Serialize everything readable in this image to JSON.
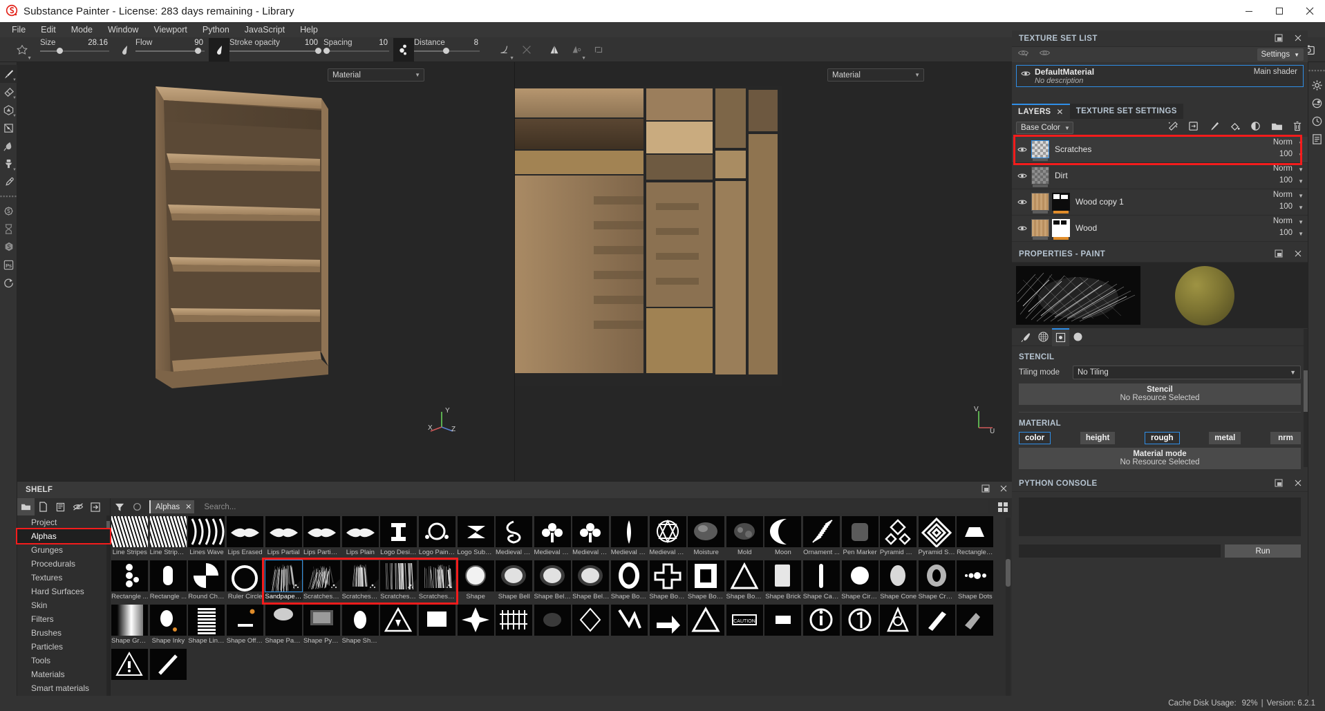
{
  "window": {
    "title": "Substance Painter - License: 283 days remaining - Library",
    "minimize": "minimize-icon",
    "maximize": "maximize-icon",
    "close": "close-icon"
  },
  "menubar": {
    "items": [
      "File",
      "Edit",
      "Mode",
      "Window",
      "Viewport",
      "Python",
      "JavaScript",
      "Help"
    ]
  },
  "toolbar": {
    "params": [
      {
        "name": "Size",
        "value": "28.16",
        "fill_pct": 28
      },
      {
        "name": "Flow",
        "value": "90",
        "fill_pct": 90
      },
      {
        "name": "Stroke opacity",
        "value": "100",
        "fill_pct": 100
      },
      {
        "name": "Spacing",
        "value": "10",
        "fill_pct": 10
      },
      {
        "name": "Distance",
        "value": "8",
        "fill_pct": 48
      }
    ],
    "icons": [
      "brush-preset-icon",
      "flow-icon",
      "opacity-icon",
      "spacing-icon",
      "falloff-icon",
      "symmetry-off-icon",
      "symmetry-icon",
      "symmetry-axis-icon",
      "tri-planar-icon",
      "pause-engine-icon",
      "uv-view-icon",
      "3d-view-icon",
      "camera-view-icon",
      "screenshot-icon"
    ]
  },
  "left_rail": {
    "tools": [
      "paint-brush-icon",
      "eraser-icon",
      "projection-icon",
      "polygon-fill-icon",
      "smudge-icon",
      "clone-stamp-icon",
      "color-picker-icon",
      "material-picker-icon",
      "bake-icon",
      "substance-icon",
      "photoshop-icon",
      "refresh-icon"
    ]
  },
  "right_rail": {
    "tools": [
      "display-settings-icon",
      "shader-settings-icon",
      "history-icon",
      "log-icon"
    ]
  },
  "viewports": {
    "view3d": {
      "channel": "Material",
      "axis": {
        "x": "X",
        "y": "Y",
        "z": "Z"
      }
    },
    "view2d": {
      "channel": "Material",
      "axis": {
        "u": "U",
        "v": "V"
      }
    }
  },
  "shelf": {
    "title": "SHELF",
    "tools": [
      "folder-icon",
      "new-icon",
      "save-icon",
      "hide-icon",
      "import-icon"
    ],
    "filter_icon": "filter-icon",
    "refresh_icon": "refresh-circle-icon",
    "chip": "Alphas",
    "chip_close": "close-icon",
    "search_placeholder": "Search...",
    "grid_view_icon": "grid-view-icon",
    "categories": [
      "Project",
      "Alphas",
      "Grunges",
      "Procedurals",
      "Textures",
      "Hard Surfaces",
      "Skin",
      "Filters",
      "Brushes",
      "Particles",
      "Tools",
      "Materials",
      "Smart materials"
    ],
    "selected_category": "Alphas",
    "highlighted_category": "Alphas",
    "items": [
      {
        "label": "Line Stripes",
        "icon": "alpha-line-stripes"
      },
      {
        "label": "Line Stripes ...",
        "icon": "alpha-line-stripes-2"
      },
      {
        "label": "Lines Wave",
        "icon": "alpha-lines-wave"
      },
      {
        "label": "Lips Erased",
        "icon": "alpha-lips-erased"
      },
      {
        "label": "Lips Partial",
        "icon": "alpha-lips-partial"
      },
      {
        "label": "Lips Partial ...",
        "icon": "alpha-lips-partial-2"
      },
      {
        "label": "Lips Plain",
        "icon": "alpha-lips-plain"
      },
      {
        "label": "Logo Desig...",
        "icon": "alpha-logo-designer"
      },
      {
        "label": "Logo Painter",
        "icon": "alpha-logo-painter"
      },
      {
        "label": "Logo Subst...",
        "icon": "alpha-logo-substance"
      },
      {
        "label": "Medieval Ce...",
        "icon": "alpha-medieval-celtic"
      },
      {
        "label": "Medieval Fl...",
        "icon": "alpha-medieval-flower"
      },
      {
        "label": "Medieval Fl...",
        "icon": "alpha-medieval-flower-2"
      },
      {
        "label": "Medieval P...",
        "icon": "alpha-medieval-pattern"
      },
      {
        "label": "Medieval S...",
        "icon": "alpha-medieval-star"
      },
      {
        "label": "Moisture",
        "icon": "alpha-moisture"
      },
      {
        "label": "Mold",
        "icon": "alpha-mold"
      },
      {
        "label": "Moon",
        "icon": "alpha-moon"
      },
      {
        "label": "Ornament ...",
        "icon": "alpha-ornament"
      },
      {
        "label": "Pen Marker",
        "icon": "alpha-pen-marker"
      },
      {
        "label": "Pyramid Do...",
        "icon": "alpha-pyramid-dots"
      },
      {
        "label": "Pyramid Stri...",
        "icon": "alpha-pyramid-stripes"
      },
      {
        "label": "Rectangle B...",
        "icon": "alpha-rectangle-bevel"
      },
      {
        "label": "Rectangle ...",
        "icon": "alpha-rectangle-dots"
      },
      {
        "label": "Rectangle ...",
        "icon": "alpha-rectangle-rounded"
      },
      {
        "label": "Round Che...",
        "icon": "alpha-round-checker"
      },
      {
        "label": "Ruler Circle",
        "icon": "alpha-ruler-circle"
      },
      {
        "label": "Sandpaper ...",
        "icon": "alpha-sandpaper",
        "selected": true
      },
      {
        "label": "Scratches D...",
        "icon": "alpha-scratches-diagonal"
      },
      {
        "label": "Scratches H...",
        "icon": "alpha-scratches-hard"
      },
      {
        "label": "Scratches P...",
        "icon": "alpha-scratches-parallel"
      },
      {
        "label": "Scratches S...",
        "icon": "alpha-scratches-scrub"
      },
      {
        "label": "Shape",
        "icon": "alpha-shape"
      },
      {
        "label": "Shape Bell",
        "icon": "alpha-shape-bell"
      },
      {
        "label": "Shape Bell ...",
        "icon": "alpha-shape-bell-2"
      },
      {
        "label": "Shape Bell ...",
        "icon": "alpha-shape-bell-3"
      },
      {
        "label": "Shape Bord...",
        "icon": "alpha-shape-border-1"
      },
      {
        "label": "Shape Bord...",
        "icon": "alpha-shape-border-cross"
      },
      {
        "label": "Shape Bord...",
        "icon": "alpha-shape-border-square"
      },
      {
        "label": "Shape Bord...",
        "icon": "alpha-shape-border-triangle"
      },
      {
        "label": "Shape Brick",
        "icon": "alpha-shape-brick"
      },
      {
        "label": "Shape Caps...",
        "icon": "alpha-shape-capsule"
      },
      {
        "label": "Shape Circl...",
        "icon": "alpha-shape-circle"
      },
      {
        "label": "Shape Cone",
        "icon": "alpha-shape-cone"
      },
      {
        "label": "Shape Cres...",
        "icon": "alpha-shape-crescent"
      },
      {
        "label": "Shape Dots",
        "icon": "alpha-shape-dots"
      },
      {
        "label": "Shape Grad...",
        "icon": "alpha-shape-gradient"
      },
      {
        "label": "Shape Inky",
        "icon": "alpha-shape-inky"
      },
      {
        "label": "Shape Lines...",
        "icon": "alpha-shape-lines"
      },
      {
        "label": "Shape Offset",
        "icon": "alpha-shape-offset"
      },
      {
        "label": "Shape Para...",
        "icon": "alpha-shape-parabola"
      },
      {
        "label": "Shape Pyra...",
        "icon": "alpha-shape-pyramid"
      },
      {
        "label": "Shape Shar...",
        "icon": "alpha-shape-sharp"
      },
      {
        "label": "",
        "icon": "alpha-row4-1"
      },
      {
        "label": "",
        "icon": "alpha-row4-2"
      },
      {
        "label": "",
        "icon": "alpha-row4-3"
      },
      {
        "label": "",
        "icon": "alpha-row4-4"
      },
      {
        "label": "",
        "icon": "alpha-row4-5"
      },
      {
        "label": "",
        "icon": "alpha-row4-6"
      },
      {
        "label": "",
        "icon": "alpha-row4-7"
      },
      {
        "label": "",
        "icon": "alpha-row4-8"
      },
      {
        "label": "",
        "icon": "alpha-row4-9"
      },
      {
        "label": "",
        "icon": "alpha-row4-10"
      },
      {
        "label": "",
        "icon": "alpha-row4-11"
      },
      {
        "label": "",
        "icon": "alpha-row4-12"
      },
      {
        "label": "",
        "icon": "alpha-row4-13"
      },
      {
        "label": "",
        "icon": "alpha-row4-14"
      },
      {
        "label": "",
        "icon": "alpha-row4-15"
      },
      {
        "label": "",
        "icon": "alpha-row4-16"
      },
      {
        "label": "",
        "icon": "alpha-row4-17"
      },
      {
        "label": "",
        "icon": "alpha-row4-18"
      }
    ],
    "highlight_range": {
      "start": 27,
      "end": 31
    }
  },
  "texture_set_list": {
    "title": "TEXTURE SET LIST",
    "settings_label": "Settings",
    "material_name": "DefaultMaterial",
    "material_description": "No description",
    "shader_label": "Main shader"
  },
  "layers_panel": {
    "tabs": [
      {
        "label": "LAYERS",
        "active": true,
        "closable": true
      },
      {
        "label": "TEXTURE SET SETTINGS",
        "active": false,
        "closable": false
      }
    ],
    "channel": "Base Color",
    "tool_icons": [
      "add-effect-icon",
      "add-fill-layer-icon",
      "add-paint-layer-icon",
      "add-fill-icon",
      "add-mask-icon",
      "add-folder-icon",
      "delete-icon"
    ],
    "layers": [
      {
        "name": "Scratches",
        "blend": "Norm",
        "opacity": "100",
        "highlighted": true,
        "selected": true,
        "type": "paint"
      },
      {
        "name": "Dirt",
        "blend": "Norm",
        "opacity": "100",
        "highlighted": false,
        "selected": false,
        "type": "paint"
      },
      {
        "name": "Wood copy 1",
        "blend": "Norm",
        "opacity": "100",
        "highlighted": false,
        "selected": false,
        "type": "fill-masked"
      },
      {
        "name": "Wood",
        "blend": "Norm",
        "opacity": "100",
        "highlighted": false,
        "selected": false,
        "type": "fill-masked"
      }
    ]
  },
  "properties_paint": {
    "title": "PROPERTIES - PAINT",
    "preview_alpha": "sandpaper-alpha-preview",
    "preview_sphere": "material-sphere-preview",
    "preview_sphere_color": "#7d7432",
    "tabs": [
      "brush-tab",
      "grid-tab",
      "stencil-tab",
      "material-tab"
    ],
    "active_tab_index": 2,
    "stencil": {
      "section": "STENCIL",
      "tiling_label": "Tiling mode",
      "tiling_value": "No Tiling",
      "drop_title": "Stencil",
      "drop_sub": "No Resource Selected"
    },
    "material": {
      "section": "MATERIAL",
      "channels": [
        {
          "label": "color",
          "on": true
        },
        {
          "label": "height",
          "on": false
        },
        {
          "label": "rough",
          "on": true
        },
        {
          "label": "metal",
          "on": false
        },
        {
          "label": "nrm",
          "on": false
        }
      ],
      "drop_title": "Material mode",
      "drop_sub": "No Resource Selected"
    }
  },
  "python_console": {
    "title": "PYTHON CONSOLE",
    "output": "",
    "input": "",
    "run_label": "Run"
  },
  "status_bar": {
    "cache_label": "Cache Disk Usage:",
    "cache_value": "92%",
    "separator": "|",
    "version": "Version: 6.2.1"
  },
  "colors": {
    "accent_blue": "#2f8fe8",
    "highlight_red": "#f41c1c",
    "panel_bg": "#333333",
    "title_text": "#b6c4d1"
  }
}
